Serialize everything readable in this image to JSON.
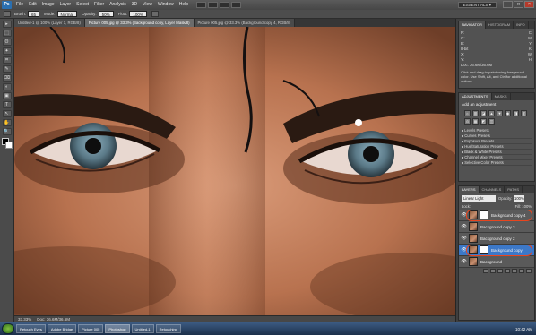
{
  "app": {
    "logo": "Ps"
  },
  "menu": [
    "File",
    "Edit",
    "Image",
    "Layer",
    "Select",
    "Filter",
    "Analysis",
    "3D",
    "View",
    "Window",
    "Help"
  ],
  "workspace": {
    "label": "ESSENTIALS ▾"
  },
  "window_buttons": [
    "–",
    "□",
    "×"
  ],
  "options_bar": {
    "brush_label": "Brush:",
    "brush_size": "65",
    "mode_label": "Mode:",
    "mode_value": "Normal",
    "opacity_label": "Opacity:",
    "opacity_value": "50%",
    "flow_label": "Flow:",
    "flow_value": "100%"
  },
  "doc_tabs": [
    "Untitled-1 @ 100% (Layer 1, RGB/8)",
    "Picture 005.jpg @ 33.3% (Background copy, Layer Mask/8)",
    "Picture 005.jpg @ 33.3% (Background copy 4, RGB/8)"
  ],
  "tools": [
    "▸",
    "⬚",
    "ʘ",
    "✦",
    "⌗",
    "✎",
    "⌫",
    "◐",
    "▣",
    "T",
    "↖",
    "✋",
    "🔍"
  ],
  "status": {
    "zoom": "33.33%",
    "doc": "Doc: 36.6M/36.6M"
  },
  "navigator": {
    "tabs": [
      "NAVIGATOR",
      "HISTOGRAM",
      "INFO"
    ],
    "rows": [
      [
        "R:",
        "C:"
      ],
      [
        "G:",
        "M:"
      ],
      [
        "B:",
        "Y:"
      ],
      [
        "8-bit",
        "K:"
      ],
      [
        "X:",
        "W:"
      ],
      [
        "Y:",
        "H:"
      ]
    ],
    "doc": "Doc: 36.6M/36.6M",
    "hint": "Click and drag to paint using foreground color. Use Shift, Alt, and Ctrl for additional options."
  },
  "adjustments": {
    "tabs": [
      "ADJUSTMENTS",
      "MASKS"
    ],
    "title": "Add an adjustment",
    "icons": [
      "☼",
      "▥",
      "◪",
      "▲",
      "▼",
      "◆",
      "◨",
      "◧",
      "⊙",
      "▦",
      "◩",
      "◫"
    ],
    "presets": [
      "Levels Presets",
      "Curves Presets",
      "Exposure Presets",
      "Hue/Saturation Presets",
      "Black & White Presets",
      "Channel Mixer Presets",
      "Selective Color Presets"
    ]
  },
  "layers": {
    "tabs": [
      "LAYERS",
      "CHANNELS",
      "PATHS"
    ],
    "blend_mode": "Linear Light",
    "opacity_label": "Opacity:",
    "opacity_value": "100%",
    "lock_label": "Lock:",
    "fill_label": "Fill: 100%",
    "items": [
      {
        "name": "Background copy 4",
        "mask": true,
        "selected": false,
        "highlight": true
      },
      {
        "name": "Background copy 3",
        "mask": false,
        "selected": false,
        "highlight": false
      },
      {
        "name": "Background copy 2",
        "mask": false,
        "selected": false,
        "highlight": false
      },
      {
        "name": "Background copy",
        "mask": true,
        "selected": true,
        "highlight": true
      },
      {
        "name": "Background",
        "mask": false,
        "selected": false,
        "highlight": false
      }
    ]
  },
  "taskbar": {
    "tasks": [
      "Retouch Eyes",
      "Adobe Bridge",
      "Picture 005",
      "Photoshop",
      "Untitled-1",
      "Retouching"
    ],
    "clock": "10:42 AM"
  },
  "colors": {
    "accent": "#3c78c8",
    "highlight": "#e8451e"
  }
}
